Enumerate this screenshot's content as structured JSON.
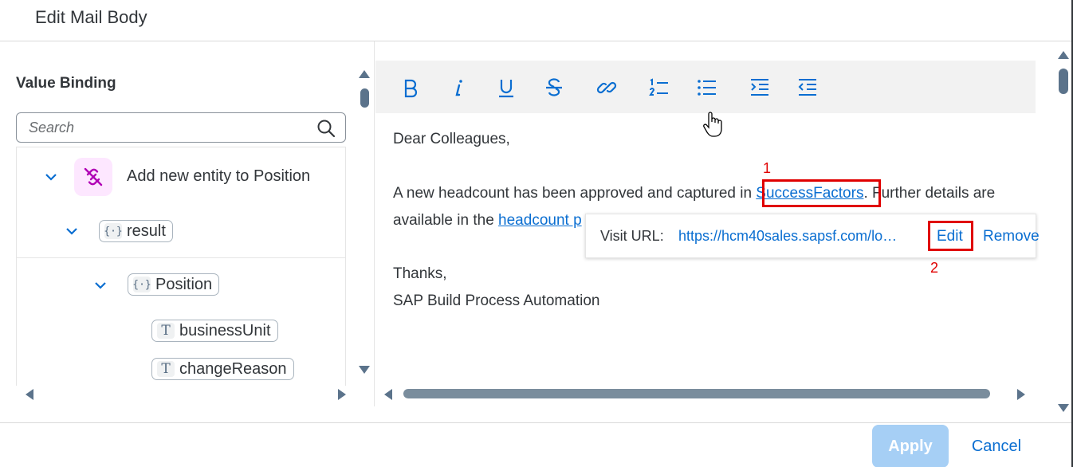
{
  "dialog": {
    "title": "Edit Mail Body"
  },
  "left_pane": {
    "title": "Value Binding",
    "search": {
      "placeholder": "Search",
      "value": ""
    },
    "tree": {
      "entity": {
        "label": "Add new entity to Position",
        "icon": "unlink-icon",
        "accent": "#b000b5"
      },
      "result": {
        "label": "result",
        "icon": "object-braces-icon"
      },
      "position": {
        "label": "Position",
        "icon": "object-braces-icon"
      },
      "fields": [
        {
          "label": "businessUnit",
          "icon": "text-T-icon"
        },
        {
          "label": "changeReason",
          "icon": "text-T-icon"
        }
      ]
    }
  },
  "toolbar": {
    "buttons": [
      "bold-icon",
      "italic-icon",
      "underline-icon",
      "strikethrough-icon",
      "link-icon",
      "numbered-list-icon",
      "bullet-list-icon",
      "indent-icon",
      "outdent-icon"
    ]
  },
  "editor": {
    "greeting": "Dear Colleagues,",
    "para_pre": "A new headcount has been approved and captured in ",
    "para_link": "SuccessFactors",
    "para_post": ". Further details are",
    "line2_pre": "available in the ",
    "line2_link": "headcount p",
    "thanks": "Thanks,",
    "signature": "SAP Build Process Automation"
  },
  "link_popover": {
    "label": "Visit URL:",
    "url": "https://hcm40sales.sapsf.com/lo…",
    "edit": "Edit",
    "remove": "Remove"
  },
  "annotations": {
    "first": "1",
    "second": "2",
    "color": "#e00000"
  },
  "footer": {
    "apply": "Apply",
    "cancel": "Cancel"
  },
  "colors": {
    "accent": "#0a6ed1",
    "apply_disabled": "#a6cff5",
    "scrollbar": "#5b738b"
  }
}
